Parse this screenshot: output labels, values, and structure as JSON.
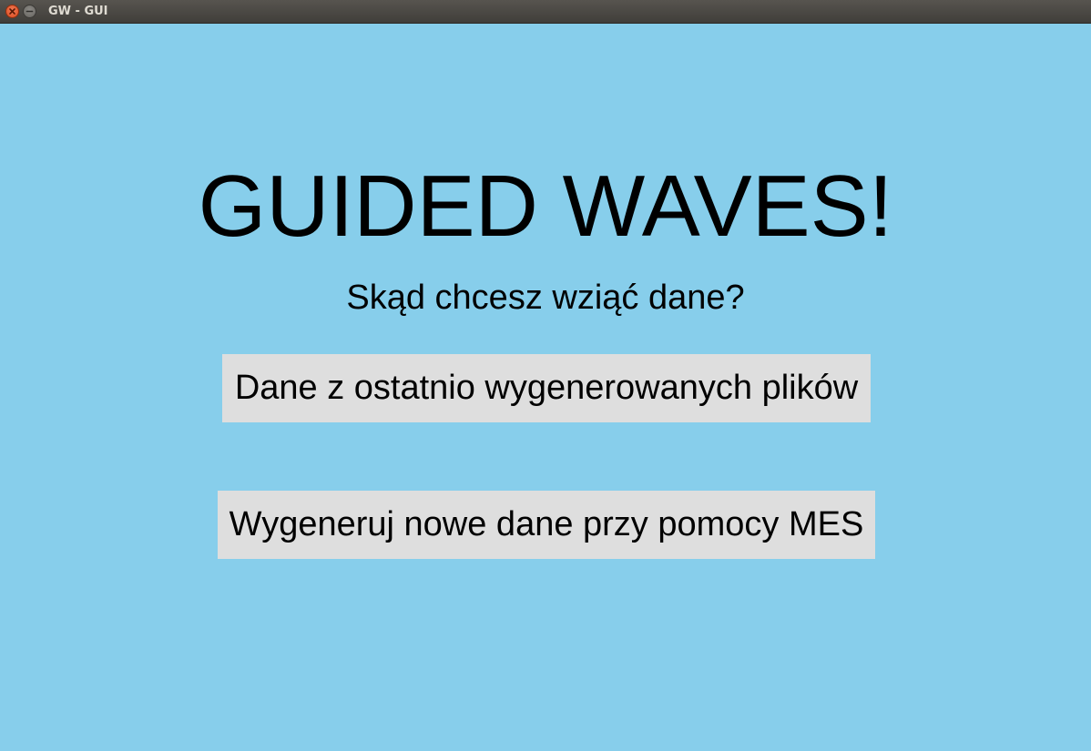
{
  "window": {
    "title": "GW - GUI",
    "background_color": "#87ceeb"
  },
  "titlebar": {
    "close_icon": "close-icon",
    "minimize_icon": "minimize-icon"
  },
  "main": {
    "heading": "GUIDED WAVES!",
    "question": "Skąd chcesz wziąć dane?",
    "buttons": [
      {
        "label": "Dane z ostatnio wygenerowanych plików"
      },
      {
        "label": "Wygeneruj nowe dane przy pomocy MES"
      }
    ],
    "button_color": "#dedede"
  }
}
